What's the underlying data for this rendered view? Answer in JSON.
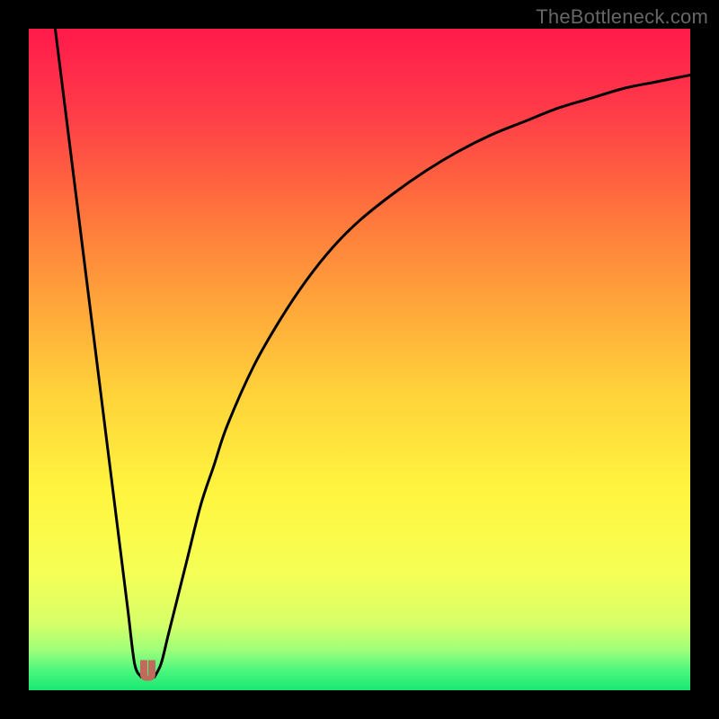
{
  "watermark": "TheBottleneck.com",
  "chart_data": {
    "type": "line",
    "title": "",
    "xlabel": "",
    "ylabel": "",
    "xlim": [
      0,
      100
    ],
    "ylim": [
      0,
      100
    ],
    "grid": false,
    "legend": false,
    "series": [
      {
        "name": "left-branch",
        "x": [
          4,
          6,
          8,
          10,
          12,
          14,
          15,
          16,
          17
        ],
        "values": [
          100,
          84,
          68,
          52,
          36,
          20,
          12,
          4,
          2
        ]
      },
      {
        "name": "right-branch",
        "x": [
          19,
          20,
          21,
          22,
          24,
          26,
          28,
          30,
          34,
          38,
          42,
          46,
          50,
          55,
          60,
          65,
          70,
          75,
          80,
          85,
          90,
          95,
          100
        ],
        "values": [
          2,
          4,
          8,
          12,
          20,
          28,
          34,
          40,
          49,
          56,
          62,
          67,
          71,
          75,
          78.5,
          81.5,
          84,
          86,
          88,
          89.5,
          91,
          92,
          93
        ]
      }
    ],
    "minimum_marker": {
      "x": 18,
      "y": 1.5,
      "color": "#c06a5c"
    },
    "background_gradient": {
      "stops": [
        {
          "offset": 0.0,
          "color": "#ff1a4b"
        },
        {
          "offset": 0.12,
          "color": "#ff3a49"
        },
        {
          "offset": 0.25,
          "color": "#ff6a3e"
        },
        {
          "offset": 0.4,
          "color": "#ffa03a"
        },
        {
          "offset": 0.55,
          "color": "#ffd23a"
        },
        {
          "offset": 0.7,
          "color": "#fff53f"
        },
        {
          "offset": 0.82,
          "color": "#f6ff55"
        },
        {
          "offset": 0.9,
          "color": "#d6ff68"
        },
        {
          "offset": 0.94,
          "color": "#9dff7a"
        },
        {
          "offset": 0.97,
          "color": "#4cf77e"
        },
        {
          "offset": 1.0,
          "color": "#18e873"
        }
      ]
    }
  }
}
